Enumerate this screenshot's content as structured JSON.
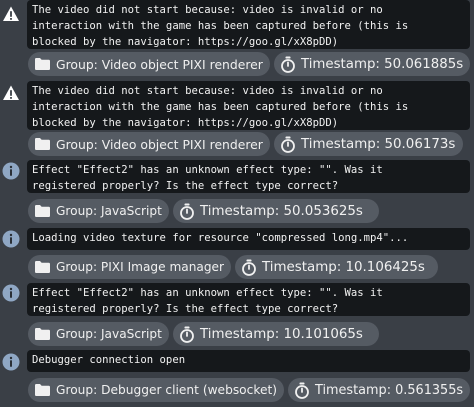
{
  "log_entries": [
    {
      "level": "warning",
      "icon": "warning-triangle-icon",
      "message": "The video did not start because: video is invalid or no\ninteraction with the game has been captured before (this is\nblocked by the navigator: https://goo.gl/xX8pDD)",
      "group": "Group: Video object PIXI renderer",
      "timestamp": "Timestamp: 50.061885s"
    },
    {
      "level": "warning",
      "icon": "warning-triangle-icon",
      "message": "The video did not start because: video is invalid or no\ninteraction with the game has been captured before (this is\nblocked by the navigator: https://goo.gl/xX8pDD)",
      "group": "Group: Video object PIXI renderer",
      "timestamp": "Timestamp: 50.06173s"
    },
    {
      "level": "info",
      "icon": "info-circle-icon",
      "message": "Effect \"Effect2\" has an unknown effect type: \"\". Was it\nregistered properly? Is the effect type correct?",
      "group": "Group: JavaScript",
      "timestamp": "Timestamp: 50.053625s"
    },
    {
      "level": "info",
      "icon": "info-circle-icon",
      "message": "Loading video texture for resource \"compressed long.mp4\"...",
      "group": "Group: PIXI Image manager",
      "timestamp": "Timestamp: 10.106425s"
    },
    {
      "level": "info",
      "icon": "info-circle-icon",
      "message": "Effect \"Effect2\" has an unknown effect type: \"\". Was it\nregistered properly? Is the effect type correct?",
      "group": "Group: JavaScript",
      "timestamp": "Timestamp: 10.101065s"
    },
    {
      "level": "info",
      "icon": "info-circle-icon",
      "message": "Debugger connection open",
      "group": "Group: Debugger client (websocket)",
      "timestamp": "Timestamp: 0.561355s"
    }
  ],
  "colors": {
    "background": "#3a3f46",
    "message_background": "#15181b",
    "chip_background": "#555b63",
    "info_icon": "#8fa7c4",
    "warning_icon": "#ffffff"
  }
}
